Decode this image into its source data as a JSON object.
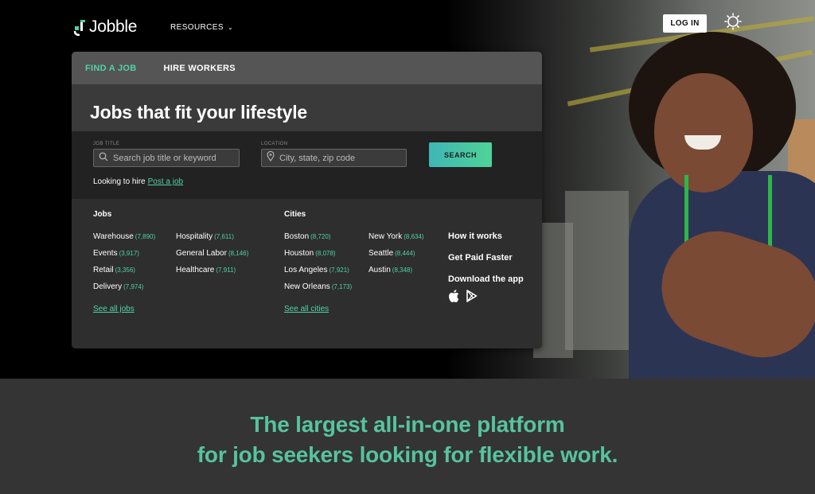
{
  "nav": {
    "logo_text": "Jobble",
    "resources_label": "RESOURCES",
    "login_label": "LOG IN",
    "theme_icon": "sun-icon"
  },
  "panel": {
    "tabs": [
      {
        "label": "FIND A JOB",
        "active": true
      },
      {
        "label": "HIRE WORKERS",
        "active": false
      }
    ],
    "headline": "Jobs that fit your lifestyle",
    "job_title": {
      "label": "JOB TITLE",
      "placeholder": "Search job title or keyword"
    },
    "location": {
      "label": "LOCATION",
      "placeholder": "City, state, zip code"
    },
    "search_label": "SEARCH",
    "hire_text": "Looking to hire",
    "post_job_link": "Post a job"
  },
  "jobs": {
    "title": "Jobs",
    "items": [
      {
        "name": "Warehouse",
        "count": "(7,890)"
      },
      {
        "name": "Events",
        "count": "(3,917)"
      },
      {
        "name": "Retail",
        "count": "(3,356)"
      },
      {
        "name": "Delivery",
        "count": "(7,974)"
      },
      {
        "name": "Hospitality",
        "count": "(7,611)"
      },
      {
        "name": "General Labor",
        "count": "(8,146)"
      },
      {
        "name": "Healthcare",
        "count": "(7,911)"
      }
    ],
    "see_all": "See all jobs"
  },
  "cities": {
    "title": "Cities",
    "items": [
      {
        "name": "Boston",
        "count": "(8,720)"
      },
      {
        "name": "Houston",
        "count": "(8,078)"
      },
      {
        "name": "Los Angeles",
        "count": "(7,921)"
      },
      {
        "name": "New Orleans",
        "count": "(7,173)"
      },
      {
        "name": "New York",
        "count": "(8,634)"
      },
      {
        "name": "Seattle",
        "count": "(8,444)"
      },
      {
        "name": "Austin",
        "count": "(8,348)"
      }
    ],
    "see_all": "See all cities"
  },
  "side_links": {
    "how_it_works": "How it works",
    "get_paid_faster": "Get Paid Faster",
    "download_app": "Download the app",
    "apple_icon": "apple-icon",
    "play_icon": "google-play-icon"
  },
  "band": {
    "line1": "The largest all-in-one platform",
    "line2": "for job seekers looking for flexible work.",
    "color": "#57c39f"
  },
  "colors": {
    "accent": "#4fd3a4",
    "panel_bg": "#2e2e2e",
    "tab_bar": "#555555"
  }
}
